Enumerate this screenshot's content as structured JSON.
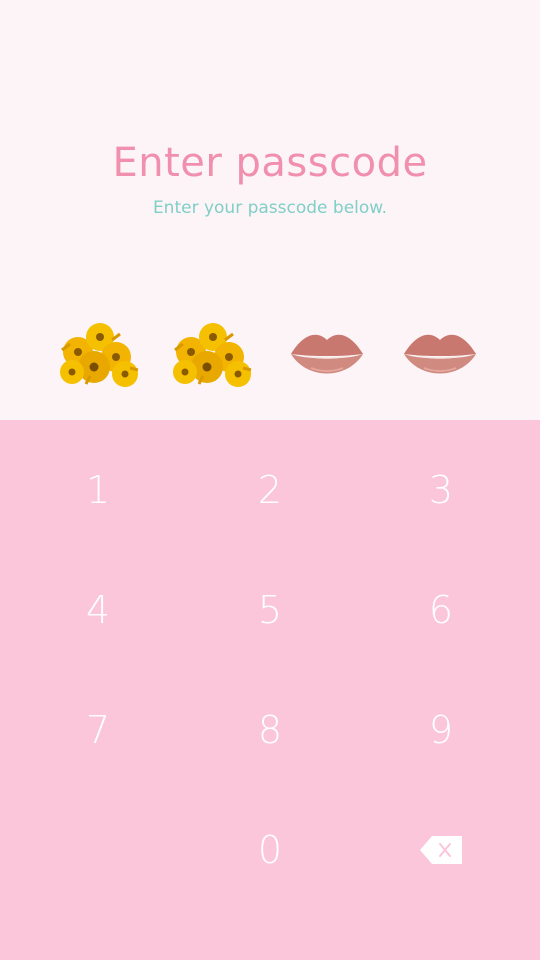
{
  "header": {
    "title": "Enter passcode",
    "subtitle": "Enter your passcode below."
  },
  "indicators": [
    {
      "icon": "sunflower-bouquet-icon",
      "filled": true
    },
    {
      "icon": "sunflower-bouquet-icon",
      "filled": true
    },
    {
      "icon": "lips-icon",
      "filled": false
    },
    {
      "icon": "lips-icon",
      "filled": false
    }
  ],
  "keypad": {
    "k1": "1",
    "k2": "2",
    "k3": "3",
    "k4": "4",
    "k5": "5",
    "k6": "6",
    "k7": "7",
    "k8": "8",
    "k9": "9",
    "k0": "0",
    "backspace_icon": "backspace-icon"
  },
  "colors": {
    "background": "#FDF4F8",
    "keypad_background": "#FBC5DA",
    "title": "#F08FAE",
    "subtitle": "#7FCFC6",
    "key_text": "#FFFFFF"
  }
}
